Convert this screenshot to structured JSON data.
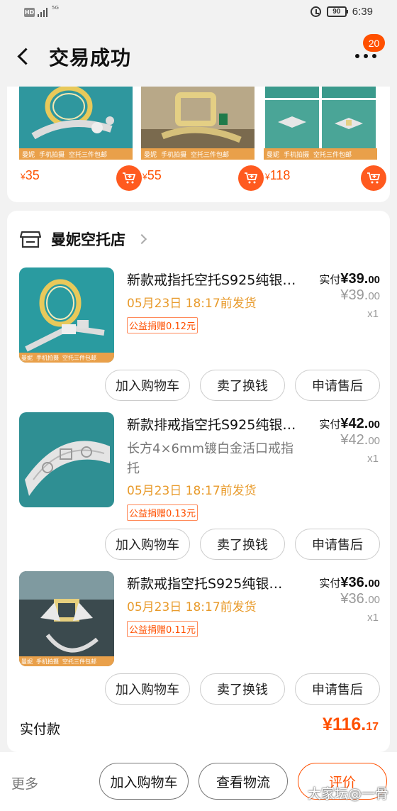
{
  "status_bar": {
    "network_badge": "HD",
    "network_type": "5G",
    "battery_level": "90",
    "time": "6:39"
  },
  "header": {
    "title": "交易成功",
    "notification_count": "20"
  },
  "recommendations": [
    {
      "tag1": "曼妮",
      "tag2": "手机拍摄",
      "tag3": "空托三件包邮",
      "currency": "¥",
      "price": "35"
    },
    {
      "tag1": "曼妮",
      "tag2": "手机拍摄",
      "tag3": "空托三件包邮",
      "currency": "¥",
      "price": "55"
    },
    {
      "tag1": "曼妮",
      "tag2": "手机拍摄",
      "tag3": "空托三件包邮",
      "currency": "¥",
      "price": "118"
    }
  ],
  "shop": {
    "name": "曼妮空托店"
  },
  "items": [
    {
      "name": "新款戒指托空托S925纯银…",
      "spec": "",
      "ship_time": "05月23日 18:17前发货",
      "charity": "公益捐赠0.12元",
      "paid_label": "实付",
      "paid_int": "¥39.",
      "paid_dec": "00",
      "orig_int": "¥39.",
      "orig_dec": "00",
      "qty": "x1",
      "thumb_tag1": "曼妮",
      "thumb_tag2": "手机拍摄",
      "thumb_tag3": "空托三件包邮"
    },
    {
      "name": "新款排戒指空托S925纯银…",
      "spec": "长方4×6mm镀白金活口戒指托",
      "ship_time": "05月23日 18:17前发货",
      "charity": "公益捐赠0.13元",
      "paid_label": "实付",
      "paid_int": "¥42.",
      "paid_dec": "00",
      "orig_int": "¥42.",
      "orig_dec": "00",
      "qty": "x1",
      "thumb_tag1": "",
      "thumb_tag2": "",
      "thumb_tag3": ""
    },
    {
      "name": "新款戒指空托S925纯银…",
      "spec": "",
      "ship_time": "05月23日 18:17前发货",
      "charity": "公益捐赠0.11元",
      "paid_label": "实付",
      "paid_int": "¥36.",
      "paid_dec": "00",
      "orig_int": "¥36.",
      "orig_dec": "00",
      "qty": "x1",
      "thumb_tag1": "曼妮",
      "thumb_tag2": "手机拍摄",
      "thumb_tag3": "空托三件包邮"
    }
  ],
  "item_actions": {
    "add_cart": "加入购物车",
    "resell": "卖了换钱",
    "after_sale": "申请售后"
  },
  "total": {
    "label": "实付款",
    "value_int": "¥116.",
    "value_dec": "17"
  },
  "bottom_bar": {
    "more": "更多",
    "add_cart": "加入购物车",
    "logistics": "查看物流",
    "review": "评价",
    "watermark": "大家坛@一骨"
  },
  "colors": {
    "accent": "#ff5000",
    "ship_text": "#e89a2a",
    "background": "#f2f2f2"
  }
}
